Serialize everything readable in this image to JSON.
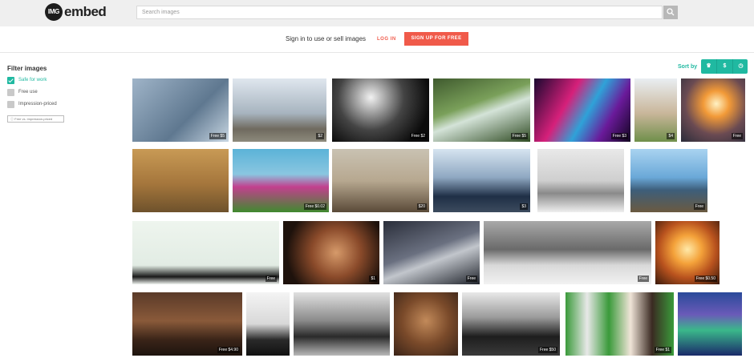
{
  "header": {
    "logo_badge": "IMG",
    "logo_text": "embed",
    "search_placeholder": "Search images"
  },
  "signin": {
    "text": "Sign in to use or sell images",
    "login_label": "LOG IN",
    "signup_label": "SIGN UP FOR FREE"
  },
  "filters": {
    "title": "Filter images",
    "options": [
      {
        "label": "Safe for work",
        "checked": true
      },
      {
        "label": "Free use",
        "checked": false
      },
      {
        "label": "Impression-priced",
        "checked": false
      }
    ],
    "button_label": "Free vs. impression-priced"
  },
  "sort": {
    "label": "Sort by",
    "options": [
      {
        "icon": "trophy-icon",
        "glyph": "♛"
      },
      {
        "icon": "dollar-icon",
        "glyph": "$"
      },
      {
        "icon": "clock-icon",
        "glyph": "◷"
      }
    ]
  },
  "images": [
    {
      "label": "Free",
      "price": "$5",
      "subject": "frost"
    },
    {
      "label": "",
      "price": "$2",
      "subject": "city bridge"
    },
    {
      "label": "Free",
      "price": "$2",
      "subject": "night figures"
    },
    {
      "label": "Free",
      "price": "$5",
      "subject": "waterfall"
    },
    {
      "label": "Free",
      "price": "$3",
      "subject": "light painting"
    },
    {
      "label": "",
      "price": "$4",
      "subject": "statue"
    },
    {
      "label": "Free",
      "price": "",
      "subject": "sunset"
    },
    {
      "label": "",
      "price": "",
      "subject": "lions"
    },
    {
      "label": "Free",
      "price": "$0.02",
      "subject": "tulips"
    },
    {
      "label": "",
      "price": "$20",
      "subject": "rooftops"
    },
    {
      "label": "",
      "price": "$3",
      "subject": "penguins"
    },
    {
      "label": "",
      "price": "",
      "subject": "snow bridge"
    },
    {
      "label": "Free",
      "price": "",
      "subject": "skyline"
    },
    {
      "label": "Free",
      "price": "",
      "subject": "birds silhouette"
    },
    {
      "label": "",
      "price": "$1",
      "subject": "calf"
    },
    {
      "label": "Free",
      "price": "",
      "subject": "bridge lights"
    },
    {
      "label": "Free",
      "price": "",
      "subject": "swimmer"
    },
    {
      "label": "Free",
      "price": "$0.50",
      "subject": "swing sunset"
    },
    {
      "label": "Free",
      "price": "$4.90",
      "subject": "balloon"
    },
    {
      "label": "",
      "price": "",
      "subject": "woman portrait"
    },
    {
      "label": "",
      "price": "",
      "subject": "horses"
    },
    {
      "label": "",
      "price": "",
      "subject": "children"
    },
    {
      "label": "Free",
      "price": "$50",
      "subject": "crowd"
    },
    {
      "label": "Free",
      "price": "$1",
      "subject": "kittens"
    },
    {
      "label": "",
      "price": "",
      "subject": "aurora tree"
    }
  ]
}
